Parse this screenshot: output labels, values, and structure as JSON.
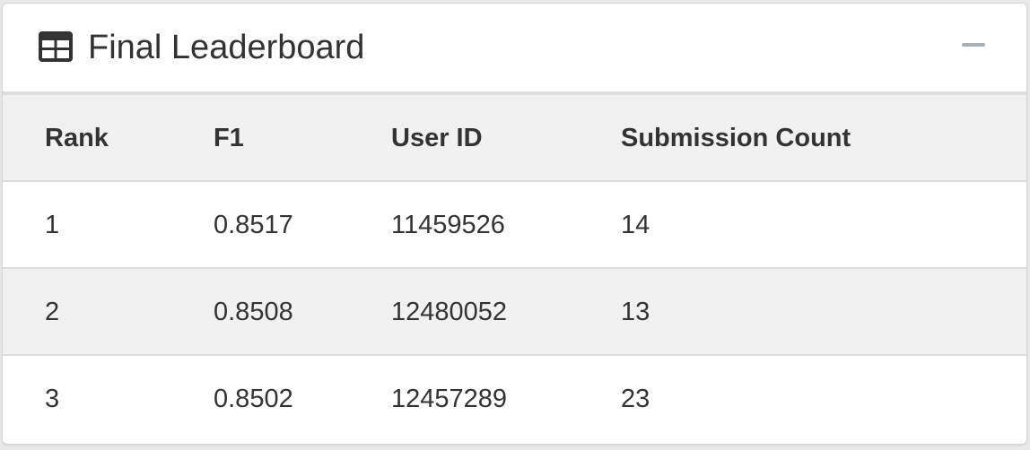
{
  "panel": {
    "title": "Final Leaderboard",
    "title_icon": "table-icon",
    "collapse_icon": "minus-icon"
  },
  "table": {
    "columns": [
      "Rank",
      "F1",
      "User ID",
      "Submission Count"
    ],
    "rows": [
      [
        "1",
        "0.8517",
        "11459526",
        "14"
      ],
      [
        "2",
        "0.8508",
        "12480052",
        "13"
      ],
      [
        "3",
        "0.8502",
        "12457289",
        "23"
      ]
    ]
  },
  "colors": {
    "header_background": "#f1f1f1",
    "stripe_background": "#f1f1f1",
    "text": "#333333",
    "collapse_icon": "#a9b0b7"
  }
}
